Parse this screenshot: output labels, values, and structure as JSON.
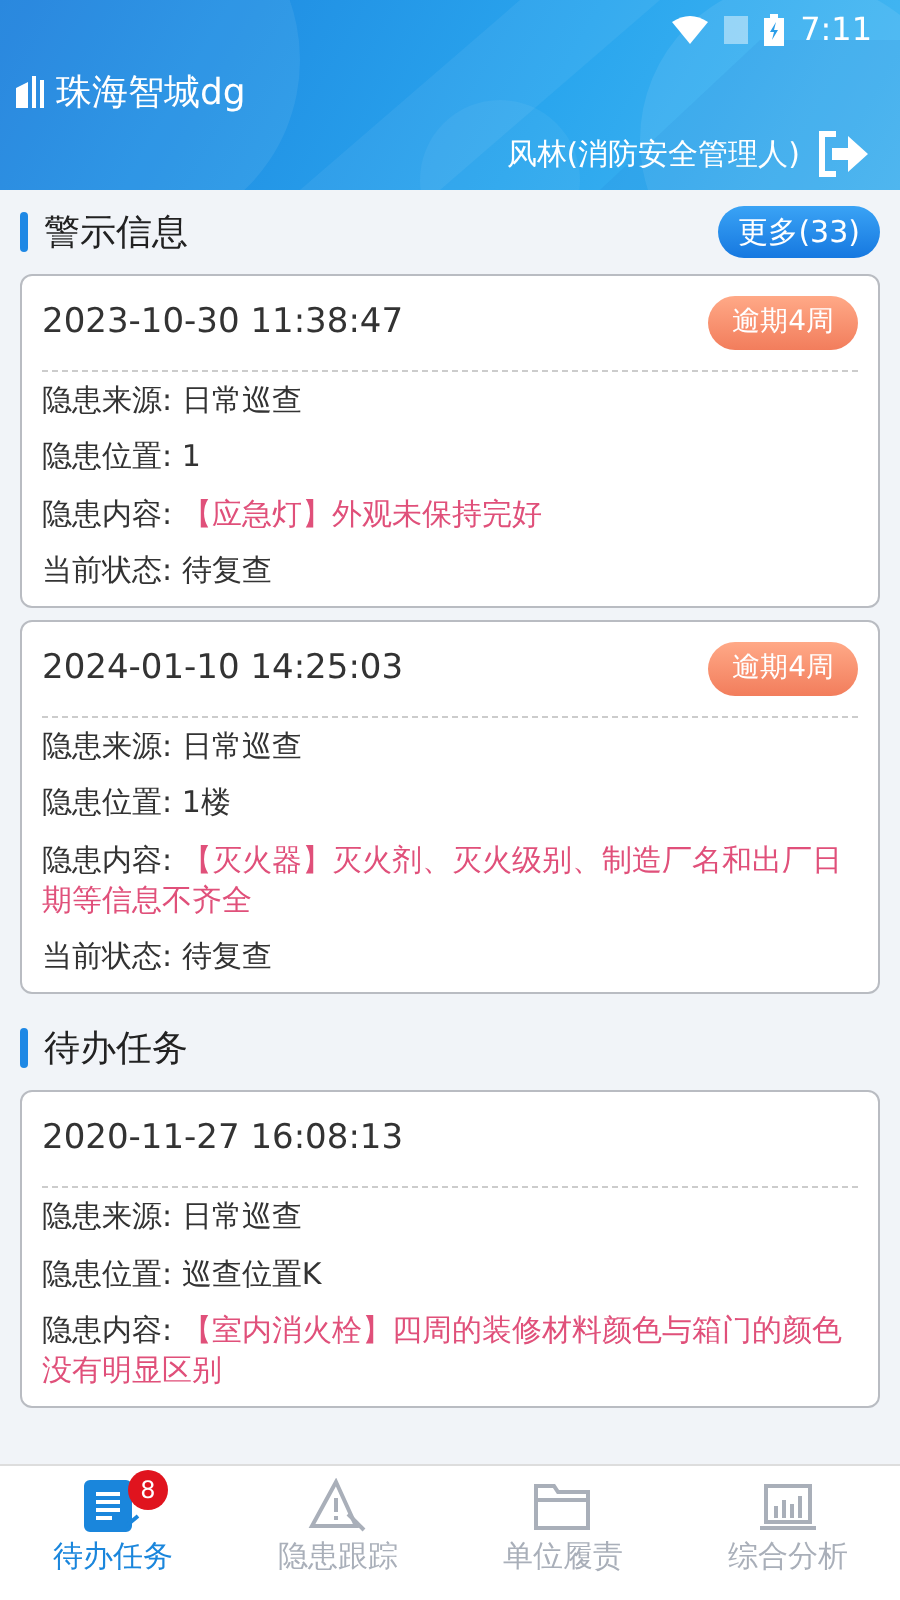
{
  "status_bar": {
    "time": "7:11"
  },
  "header": {
    "app_title": "珠海智城dg",
    "user": "风林(消防安全管理人)"
  },
  "sections": [
    {
      "title": "警示信息",
      "more": "更多(33)",
      "cards": [
        {
          "time": "2023-10-30 11:38:47",
          "badge": "逾期4周",
          "rows": [
            {
              "label": "隐患来源: ",
              "value": "日常巡查",
              "kind": "plain"
            },
            {
              "label": "隐患位置: ",
              "value": "1",
              "kind": "plain"
            },
            {
              "label": "隐患内容: ",
              "value": "【应急灯】外观未保持完好",
              "kind": "hazard"
            },
            {
              "label": "当前状态: ",
              "value": "待复查",
              "kind": "plain"
            }
          ]
        },
        {
          "time": "2024-01-10 14:25:03",
          "badge": "逾期4周",
          "rows": [
            {
              "label": "隐患来源: ",
              "value": "日常巡查",
              "kind": "plain"
            },
            {
              "label": "隐患位置: ",
              "value": "1楼",
              "kind": "plain"
            },
            {
              "label": "隐患内容: ",
              "value": "【灭火器】灭火剂、灭火级别、制造厂名和出厂日期等信息不齐全",
              "kind": "hazard"
            },
            {
              "label": "当前状态: ",
              "value": "待复查",
              "kind": "plain"
            }
          ]
        }
      ]
    },
    {
      "title": "待办任务",
      "cards": [
        {
          "time": "2020-11-27 16:08:13",
          "rows": [
            {
              "label": "隐患来源: ",
              "value": "日常巡查",
              "kind": "plain"
            },
            {
              "label": "隐患位置: ",
              "value": "巡查位置K",
              "kind": "plain"
            },
            {
              "label": "隐患内容: ",
              "value": "【室内消火栓】四周的装修材料颜色与箱门的颜色没有明显区别",
              "kind": "hazard"
            }
          ]
        }
      ]
    }
  ],
  "tabs": [
    {
      "label": "待办任务",
      "selected": true,
      "badge": "8",
      "kind": "tasks"
    },
    {
      "label": "隐患跟踪",
      "selected": false,
      "kind": "warning"
    },
    {
      "label": "单位履责",
      "selected": false,
      "kind": "folder"
    },
    {
      "label": "综合分析",
      "selected": false,
      "kind": "chart"
    }
  ]
}
